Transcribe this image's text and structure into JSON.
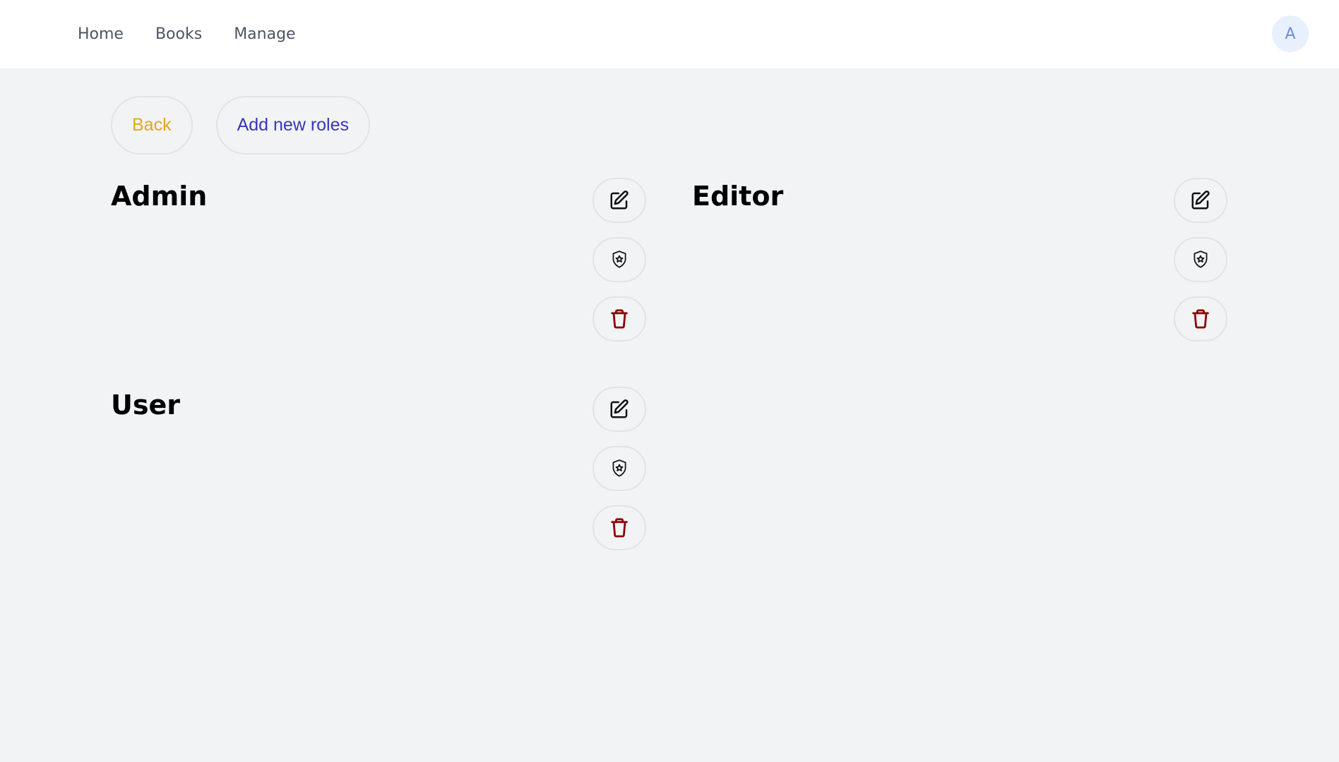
{
  "nav": {
    "items": [
      {
        "label": "Home"
      },
      {
        "label": "Books"
      },
      {
        "label": "Manage"
      }
    ]
  },
  "user": {
    "avatar_initial": "A"
  },
  "toolbar": {
    "back_label": "Back",
    "add_label": "Add new roles"
  },
  "roles": [
    {
      "name": "Admin"
    },
    {
      "name": "Editor"
    },
    {
      "name": "User"
    }
  ],
  "icons": {
    "edit": "edit-icon",
    "permissions": "shield-star-icon",
    "delete": "trash-icon"
  },
  "colors": {
    "back": "#e0a81e",
    "add": "#3a35b8",
    "delete": "#8b0000",
    "background": "#f2f3f5"
  }
}
